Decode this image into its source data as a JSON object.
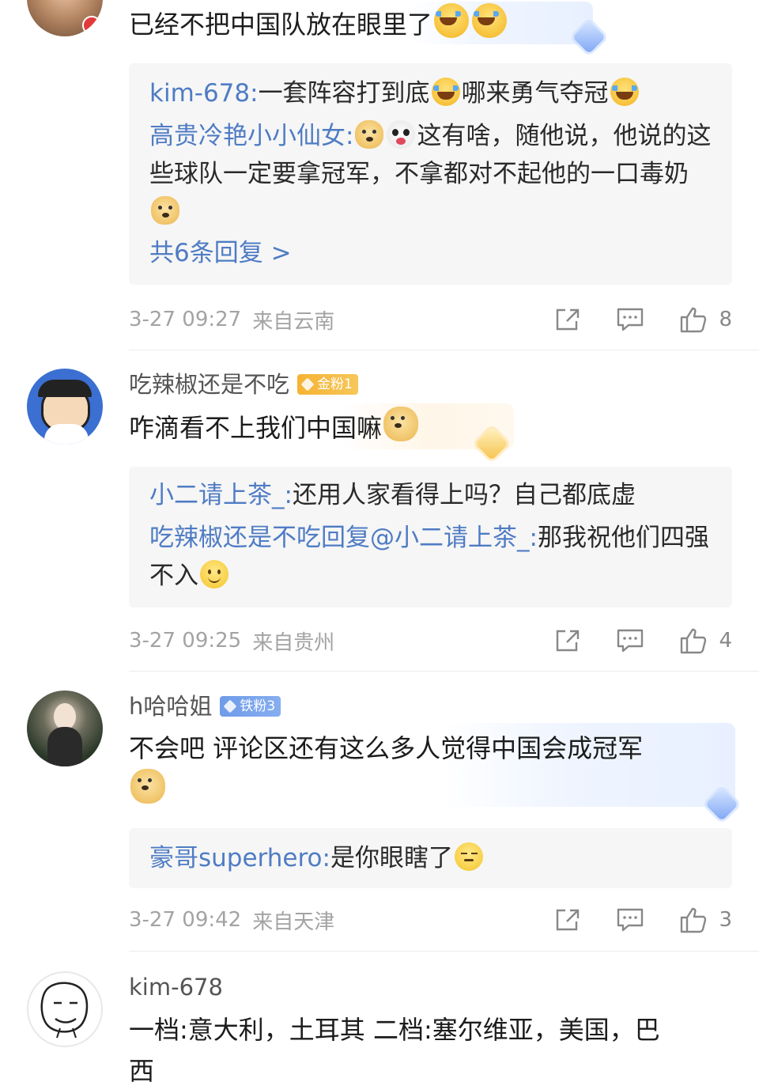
{
  "comments": [
    {
      "text": "已经不把中国队放在眼里了",
      "replies": [
        {
          "name": "kim-678:",
          "text_a": "一套阵容打到底",
          "text_b": "哪来勇气夺冠"
        },
        {
          "name": "高贵冷艳小小仙女:",
          "text": "这有啥，随他说，他说的这些球队一定要拿冠军，不拿都对不起他的一口毒奶"
        }
      ],
      "more_replies": "共6条回复 >",
      "time": "3-27 09:27",
      "location": "来自云南",
      "likes": "8"
    },
    {
      "username": "吃辣椒还是不吃",
      "badge": "金粉1",
      "text": "咋滴看不上我们中国嘛",
      "replies": [
        {
          "name": "小二请上茶_:",
          "text": "还用人家看得上吗？自己都底虚"
        },
        {
          "name": "吃辣椒还是不吃回复@小二请上茶_:",
          "text": "那我祝他们四强不入"
        }
      ],
      "time": "3-27 09:25",
      "location": "来自贵州",
      "likes": "4"
    },
    {
      "username": "h哈哈姐",
      "badge": "铁粉3",
      "text": "不会吧 评论区还有这么多人觉得中国会成冠军",
      "replies": [
        {
          "name": "豪哥superhero:",
          "text": "是你眼瞎了"
        }
      ],
      "time": "3-27 09:42",
      "location": "来自天津",
      "likes": "3"
    },
    {
      "username": "kim-678",
      "text_line1": "一档:意大利，土耳其 二档:塞尔维亚，美国，巴",
      "text_line2": "西"
    }
  ],
  "colors": {
    "link": "#4f7cc4",
    "meta": "#a3a3a3",
    "reply_bg": "#f6f6f6"
  },
  "icons": [
    "share-icon",
    "comment-icon",
    "like-icon",
    "laugh-cry-emoji",
    "doge-emoji",
    "panda-emoji",
    "smile-emoji",
    "wink-emoji",
    "gem-icon"
  ]
}
